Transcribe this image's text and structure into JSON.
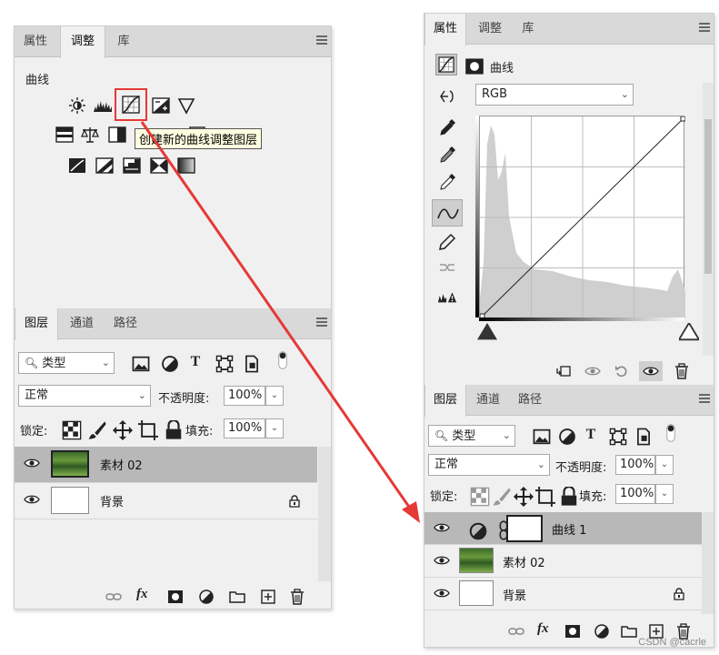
{
  "left_panel": {
    "tabs": [
      "属性",
      "调整",
      "库"
    ],
    "active_tab": "调整",
    "section_label": "曲线",
    "tooltip": "创建新的曲线调整图层",
    "layers_tabs": [
      "图层",
      "通道",
      "路径"
    ],
    "kind_filter": "类型",
    "blend_mode": "正常",
    "opacity_label": "不透明度:",
    "opacity_value": "100%",
    "lock_label": "锁定:",
    "fill_label": "填充:",
    "fill_value": "100%",
    "layers": [
      {
        "name": "素材 02",
        "selected": true
      },
      {
        "name": "背景",
        "selected": false,
        "locked": true
      }
    ]
  },
  "right_panel": {
    "tabs": [
      "属性",
      "调整",
      "库"
    ],
    "active_tab": "属性",
    "props_title": "曲线",
    "channel": "RGB",
    "layers_tabs": [
      "图层",
      "通道",
      "路径"
    ],
    "kind_filter": "类型",
    "blend_mode": "正常",
    "opacity_label": "不透明度:",
    "opacity_value": "100%",
    "lock_label": "锁定:",
    "fill_label": "填充:",
    "fill_value": "100%",
    "layers": [
      {
        "name": "曲线 1",
        "selected": true
      },
      {
        "name": "素材 02",
        "selected": false
      },
      {
        "name": "背景",
        "selected": false,
        "locked": true
      }
    ]
  },
  "watermark": "CSDN @cacrle",
  "colors": {
    "accent_red": "#e53935",
    "panel_bg": "#f0f0f0",
    "selected_row": "#b8b8b8"
  }
}
